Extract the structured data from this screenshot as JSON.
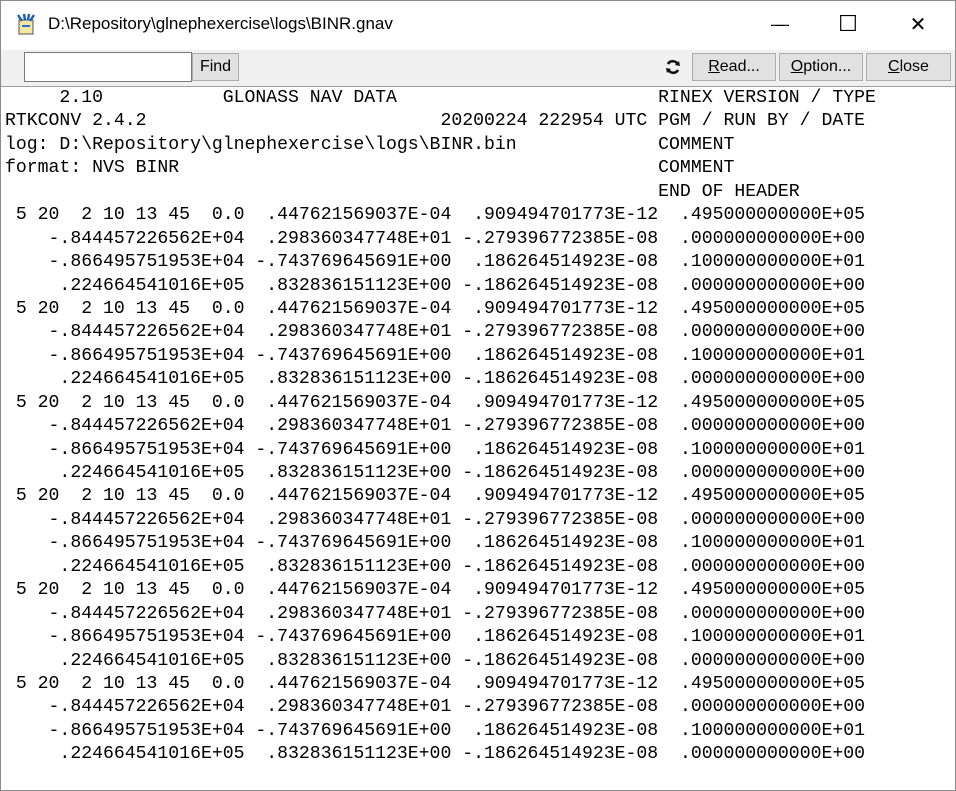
{
  "window": {
    "title": "D:\\Repository\\glnephexercise\\logs\\BINR.gnav",
    "controls": {
      "minimize": "—",
      "maximize": "☐",
      "close": "✕"
    }
  },
  "toolbar": {
    "search_value": "",
    "find_label": "Find",
    "refresh_icon": "refresh-icon",
    "read_label": "Read...",
    "option_label": "Option...",
    "close_label": "Close"
  },
  "content": {
    "header_lines": [
      {
        "content": "     2.10           GLONASS NAV DATA",
        "label": "RINEX VERSION / TYPE"
      },
      {
        "content": "RTKCONV 2.4.2                           20200224 222954 UTC",
        "label": "PGM / RUN BY / DATE"
      },
      {
        "content": "log: D:\\Repository\\glnephexercise\\logs\\BINR.bin",
        "label": "COMMENT"
      },
      {
        "content": "format: NVS BINR",
        "label": "COMMENT"
      },
      {
        "content": "",
        "label": "END OF HEADER"
      }
    ],
    "records": [
      [
        " 5 20  2 10 13 45  0.0  .447621569037E-04  .909494701773E-12  .495000000000E+05",
        "    -.844457226562E+04  .298360347748E+01 -.279396772385E-08  .000000000000E+00",
        "    -.866495751953E+04 -.743769645691E+00  .186264514923E-08  .100000000000E+01",
        "     .224664541016E+05  .832836151123E+00 -.186264514923E-08  .000000000000E+00"
      ],
      [
        " 5 20  2 10 13 45  0.0  .447621569037E-04  .909494701773E-12  .495000000000E+05",
        "    -.844457226562E+04  .298360347748E+01 -.279396772385E-08  .000000000000E+00",
        "    -.866495751953E+04 -.743769645691E+00  .186264514923E-08  .100000000000E+01",
        "     .224664541016E+05  .832836151123E+00 -.186264514923E-08  .000000000000E+00"
      ],
      [
        " 5 20  2 10 13 45  0.0  .447621569037E-04  .909494701773E-12  .495000000000E+05",
        "    -.844457226562E+04  .298360347748E+01 -.279396772385E-08  .000000000000E+00",
        "    -.866495751953E+04 -.743769645691E+00  .186264514923E-08  .100000000000E+01",
        "     .224664541016E+05  .832836151123E+00 -.186264514923E-08  .000000000000E+00"
      ],
      [
        " 5 20  2 10 13 45  0.0  .447621569037E-04  .909494701773E-12  .495000000000E+05",
        "    -.844457226562E+04  .298360347748E+01 -.279396772385E-08  .000000000000E+00",
        "    -.866495751953E+04 -.743769645691E+00  .186264514923E-08  .100000000000E+01",
        "     .224664541016E+05  .832836151123E+00 -.186264514923E-08  .000000000000E+00"
      ],
      [
        " 5 20  2 10 13 45  0.0  .447621569037E-04  .909494701773E-12  .495000000000E+05",
        "    -.844457226562E+04  .298360347748E+01 -.279396772385E-08  .000000000000E+00",
        "    -.866495751953E+04 -.743769645691E+00  .186264514923E-08  .100000000000E+01",
        "     .224664541016E+05  .832836151123E+00 -.186264514923E-08  .000000000000E+00"
      ],
      [
        " 5 20  2 10 13 45  0.0  .447621569037E-04  .909494701773E-12  .495000000000E+05",
        "    -.844457226562E+04  .298360347748E+01 -.279396772385E-08  .000000000000E+00",
        "    -.866495751953E+04 -.743769645691E+00  .186264514923E-08  .100000000000E+01",
        "     .224664541016E+05  .832836151123E+00 -.186264514923E-08  .000000000000E+00"
      ]
    ]
  }
}
